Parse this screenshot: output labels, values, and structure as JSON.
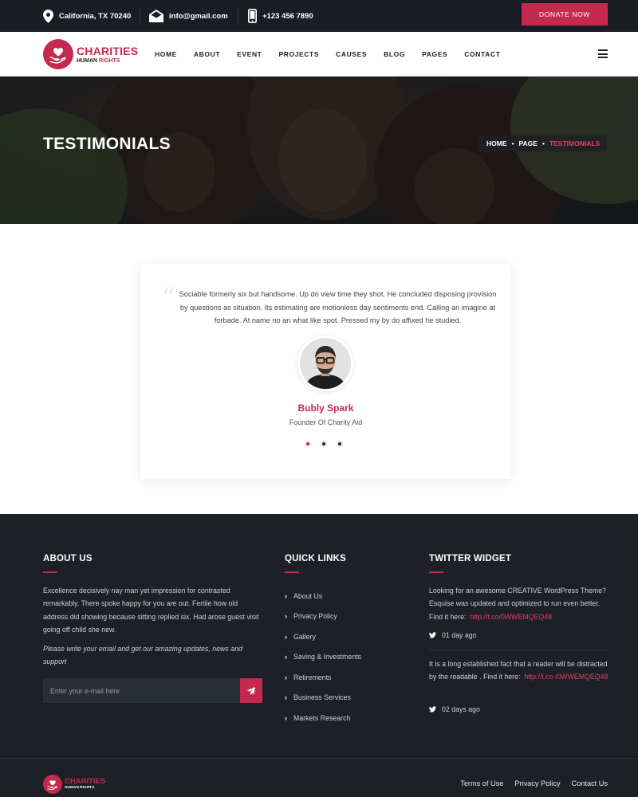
{
  "topbar": {
    "location": "California, TX 70240",
    "email": "info@gmail.com",
    "phone": "+123 456 7890",
    "donate_label": "DONATE NOW"
  },
  "header": {
    "logo_title": "CHARITIES",
    "logo_sub_part1": "HUMAN",
    "logo_sub_part2": "RIGHTS",
    "nav": [
      "HOME",
      "ABOUT",
      "EVENT",
      "PROJECTS",
      "CAUSES",
      "BLOG",
      "PAGES",
      "CONTACT"
    ]
  },
  "banner": {
    "title": "TESTIMONIALS",
    "breadcrumb": [
      "HOME",
      "PAGE",
      "TESTIMONIALS"
    ]
  },
  "testimonial": {
    "quote": "Sociable formerly six but handsome. Up do view time they shot. He concluded disposing provision by questions as situation. Its estimating are motionless day sentiments end. Calling an imagine at forbade. At name no an what like spot. Pressed my by do affixed he studied.",
    "name": "Bubly Spark",
    "role": "Founder Of Charity Aid",
    "active_dot": 1,
    "dot_count": 3
  },
  "footer": {
    "about": {
      "heading": "ABOUT US",
      "text": "Excellence decisively nay man yet impression for contrasted remarkably. There spoke happy for you are out. Fertile how old address did showing because sitting replied six. Had arose guest visit going off child she new.",
      "note": "Please write your email and get our amazing updates, news and support",
      "email_placeholder": "Enter your e-mail here"
    },
    "quick_links": {
      "heading": "QUICK LINKS",
      "items": [
        "About Us",
        "Privacy Policy",
        "Gallery",
        "Saving & Investments",
        "Retirements",
        "Business Services",
        "Markets Research"
      ]
    },
    "twitter": {
      "heading": "TWITTER WIDGET",
      "tweets": [
        {
          "text": "Looking for an awesome CREATIVE WordPress Theme? Esquise was updated and optimized to run even better. Find it here:",
          "link": "http://t.co/0WWEMQEQ48",
          "time": "01 day ago"
        },
        {
          "text": "It is a long established fact that a reader will be distracted by the readable . Find it here:",
          "link": "http://t.co /0WWEMQEQ48",
          "time": "02 days ago"
        }
      ]
    },
    "bottom": {
      "logo_title": "CHARITIES",
      "logo_sub": "HUMAN RIGHTS",
      "links": [
        "Terms of Use",
        "Privacy Policy",
        "Contact Us"
      ]
    }
  },
  "colors": {
    "accent": "#c6294e",
    "dark": "#1d2026",
    "topbar": "#1a1d23"
  }
}
